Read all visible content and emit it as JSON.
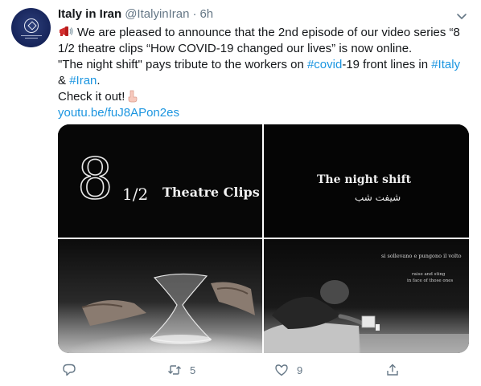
{
  "tweet": {
    "author_name": "Italy in Iran",
    "handle": "@ItalyinIran",
    "separator": "·",
    "time": "6h",
    "avatar_icon": "embassy-emblem-avatar",
    "text_line1_part1": "We are pleased to announce that the 2nd episode of our video series “8 1/2 theatre clips “How COVID-19 changed our lives” is now online.",
    "text_line2_part1": "\"The night shift\" pays tribute to the workers on ",
    "hashtag_covid": "#covid",
    "text_line2_part2": "-19 front lines in ",
    "hashtag_italy": "#Italy",
    "text_line3_amp": "& ",
    "hashtag_iran": "#Iran",
    "text_line3_end": ".",
    "check_it_out": "Check it out!",
    "url": "youtu.be/fuJ8APon2es",
    "icons": [
      "megaphone-emoji",
      "pointing-down-hand-emoji",
      "chevron-down-icon"
    ]
  },
  "media": {
    "tile1": {
      "big_digit": "8",
      "fraction": "1/2",
      "title": "Theatre Clips"
    },
    "tile2": {
      "title": "The night shift",
      "subtitle_farsi": "شیفت شب"
    },
    "tile3": {
      "description": "hands holding hourglass"
    },
    "tile4": {
      "caption_line1": "si sollevano e pungono il volto",
      "caption_line2": "raise and sting",
      "caption_line3": "in face of those ones"
    }
  },
  "actions": {
    "reply_icon": "reply-icon",
    "retweet_icon": "retweet-icon",
    "retweet_count": "5",
    "like_icon": "heart-icon",
    "like_count": "9",
    "share_icon": "share-icon"
  },
  "colors": {
    "link": "#1b95e0",
    "text": "#14171a",
    "secondary": "#657786"
  }
}
